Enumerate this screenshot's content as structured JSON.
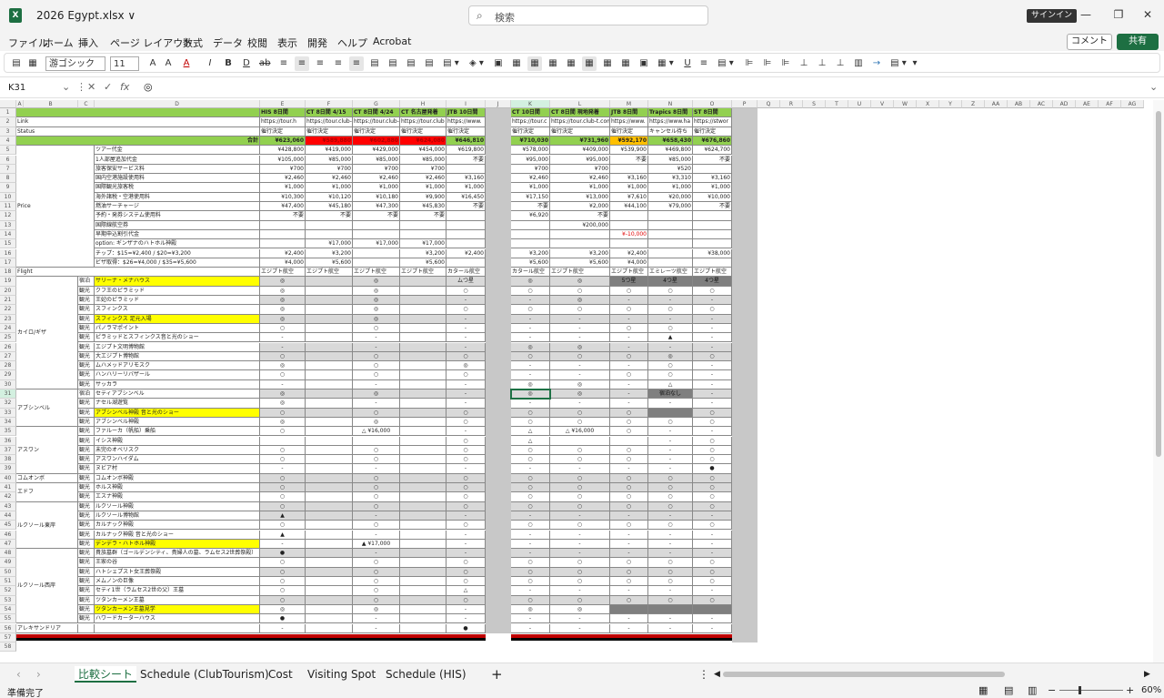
{
  "titlebar": {
    "file_title": "2026 Egypt.xlsx ∨",
    "search_placeholder": "検索",
    "signin_label": "サインイン",
    "minimize": "—",
    "restore": "❐",
    "close": "✕"
  },
  "menu": {
    "items": [
      "ファイル",
      "ホーム",
      "挿入",
      "ページ レイアウト",
      "数式",
      "データ",
      "校閲",
      "表示",
      "開発",
      "ヘルプ",
      "Acrobat"
    ],
    "comment_label": "コメント",
    "share_label": "共有"
  },
  "ribbon": {
    "font_name": "游ゴシック",
    "font_size": "11"
  },
  "formula_bar": {
    "cell_ref": "K31",
    "content": "◎"
  },
  "columns": [
    "A",
    "B",
    "C",
    "D",
    "E",
    "F",
    "G",
    "H",
    "I",
    "J",
    "K",
    "L",
    "M",
    "N",
    "O",
    "P",
    "Q",
    "R",
    "S",
    "T",
    "U",
    "V",
    "W",
    "X",
    "Y",
    "Z",
    "AA",
    "AB",
    "AC",
    "AD",
    "AE",
    "AF",
    "AG"
  ],
  "table": {
    "headers": [
      "HIS 8日間",
      "CT 8日間 4/15",
      "CT 8日間 4/24",
      "CT 名古屋発着",
      "JTB 10日間",
      "CT 10日間",
      "CT 8日間 現地発着",
      "JTB 8日間",
      "Trapics 8日間",
      "ST 8日間"
    ],
    "link_label": "Link",
    "links": [
      "https://tour.h",
      "https://tour.club-",
      "https://tour.club-",
      "https://tour.club",
      "https://www.",
      "https://tour.c",
      "https://tour.club-t.com",
      "https://www.",
      "https://www.ha",
      "https://stwor"
    ],
    "status_label": "Status",
    "statuses": [
      "催行決定",
      "催行決定",
      "催行決定",
      "催行決定",
      "催行決定",
      "催行決定",
      "催行決定",
      "催行決定",
      "キャンセル待ち",
      "催行決定"
    ],
    "total_label": "合計",
    "totals": [
      "¥623,060",
      "¥589,880",
      "¥602,880",
      "¥624,080",
      "¥646,810",
      "¥710,030",
      "¥731,960",
      "¥592,170",
      "¥658,430",
      "¥676,860"
    ],
    "price_label": "Price",
    "price_items": [
      {
        "label": "ツアー代金",
        "values": [
          "¥428,800",
          "¥419,000",
          "¥429,000",
          "¥454,000",
          "¥619,800",
          "¥578,000",
          "¥409,000",
          "¥539,900",
          "¥469,800",
          "¥624,700"
        ]
      },
      {
        "label": "1人部屋追加代金",
        "values": [
          "¥105,000",
          "¥85,000",
          "¥85,000",
          "¥85,000",
          "不要",
          "¥95,000",
          "¥95,000",
          "不要",
          "¥85,000",
          "不要"
        ]
      },
      {
        "label": "旅客保安サービス料",
        "values": [
          "¥700",
          "¥700",
          "¥700",
          "¥700",
          "",
          "¥700",
          "¥700",
          "",
          "¥520",
          ""
        ]
      },
      {
        "label": "国内空港施設使用料",
        "values": [
          "¥2,460",
          "¥2,460",
          "¥2,460",
          "¥2,460",
          "¥3,160",
          "¥2,460",
          "¥2,460",
          "¥3,160",
          "¥3,310",
          "¥3,160"
        ]
      },
      {
        "label": "国際観光旅客税",
        "values": [
          "¥1,000",
          "¥1,000",
          "¥1,000",
          "¥1,000",
          "¥1,000",
          "¥1,000",
          "¥1,000",
          "¥1,000",
          "¥1,000",
          "¥1,000"
        ]
      },
      {
        "label": "海外諸税・空港使用料",
        "values": [
          "¥10,300",
          "¥10,120",
          "¥10,180",
          "¥9,900",
          "¥16,450",
          "¥17,150",
          "¥13,000",
          "¥7,610",
          "¥20,000",
          "¥10,000"
        ]
      },
      {
        "label": "燃油サーチャージ",
        "values": [
          "¥47,400",
          "¥45,180",
          "¥47,300",
          "¥45,830",
          "不要",
          "不要",
          "¥2,000",
          "¥44,100",
          "¥79,000",
          "不要"
        ]
      },
      {
        "label": "予約・発券システム使用料",
        "values": [
          "不要",
          "不要",
          "不要",
          "不要",
          "",
          "¥6,920",
          "不要",
          "",
          "",
          ""
        ]
      },
      {
        "label": "国際線航空券",
        "values": [
          "",
          "",
          "",
          "",
          "",
          "",
          "¥200,000",
          "",
          "",
          ""
        ]
      },
      {
        "label": "早期申込割引代金",
        "values": [
          "",
          "",
          "",
          "",
          "",
          "",
          "",
          "¥-10,000",
          "",
          ""
        ]
      },
      {
        "label": "option: ギンザナのハトホル神殿",
        "values": [
          "",
          "¥17,000",
          "¥17,000",
          "¥17,000",
          "",
          "",
          "",
          "",
          "",
          ""
        ]
      },
      {
        "label": "チップ：$15=¥2,400 / $20=¥3,200",
        "values": [
          "¥2,400",
          "¥3,200",
          "",
          "¥3,200",
          "¥2,400",
          "¥3,200",
          "¥3,200",
          "¥2,400",
          "",
          "¥38,000"
        ]
      },
      {
        "label": "ビザ取得：$26=¥4,000 / $35=¥5,600",
        "values": [
          "¥4,000",
          "¥5,600",
          "",
          "¥5,600",
          "",
          "¥5,600",
          "¥5,600",
          "¥4,000",
          "",
          ""
        ]
      }
    ],
    "flight_label": "Flight",
    "flights": [
      "エジプト航空",
      "エジプト航空",
      "エジプト航空",
      "エジプト航空",
      "カタール航空",
      "カタール航空",
      "エジプト航空",
      "エジプト航空",
      "エミレーツ航空",
      "エジプト航空"
    ],
    "regions": [
      "カイロ/ギザ",
      "アブシンベル",
      "アスワン",
      "コムオンボ",
      "エドフ",
      "ルクソール東岸",
      "ルクソール西岸",
      "アレキサンドリア"
    ],
    "sights": [
      {
        "type": "宿泊",
        "name": "サリーナ・メナハウス",
        "yellow": true,
        "v": [
          "◎",
          "",
          "◎",
          "",
          "ムつ星",
          "◎",
          "◎",
          "5つ星",
          "4つ星",
          "4つ星"
        ]
      },
      {
        "type": "観光",
        "name": "クフ王のピラミッド",
        "v": [
          "◎",
          "",
          "◎",
          "",
          "○",
          "○",
          "○",
          "○",
          "○",
          "○"
        ]
      },
      {
        "type": "観光",
        "name": "王妃のピラミッド",
        "v": [
          "◎",
          "",
          "◎",
          "",
          "-",
          "-",
          "◎",
          "-",
          "-",
          "-"
        ]
      },
      {
        "type": "観光",
        "name": "スフィンクス",
        "v": [
          "◎",
          "",
          "◎",
          "",
          "○",
          "○",
          "○",
          "○",
          "○",
          "○"
        ]
      },
      {
        "type": "観光",
        "name": "スフィンクス 足元入場",
        "yellow": true,
        "v": [
          "◎",
          "",
          "◎",
          "",
          "-",
          "-",
          "-",
          "-",
          "-",
          "-"
        ]
      },
      {
        "type": "観光",
        "name": "パノラマポイント",
        "v": [
          "○",
          "",
          "○",
          "",
          "-",
          "-",
          "-",
          "○",
          "○",
          "-"
        ]
      },
      {
        "type": "観光",
        "name": "ピラミッドとスフィンクス音と光のショー",
        "v": [
          "-",
          "",
          "-",
          "",
          "-",
          "-",
          "-",
          "-",
          "▲",
          "-"
        ]
      },
      {
        "type": "観光",
        "name": "エジプト文明博物館",
        "v": [
          "-",
          "",
          "-",
          "",
          "-",
          "◎",
          "◎",
          "-",
          "-",
          "-"
        ]
      },
      {
        "type": "観光",
        "name": "大エジプト博物館",
        "v": [
          "○",
          "",
          "○",
          "",
          "○",
          "○",
          "○",
          "○",
          "◎",
          "○"
        ]
      },
      {
        "type": "観光",
        "name": "ムハメッドアリモスク",
        "v": [
          "◎",
          "",
          "○",
          "",
          "◎",
          "-",
          "-",
          "-",
          "○",
          "-"
        ]
      },
      {
        "type": "観光",
        "name": "ハンハリーリバザール",
        "v": [
          "○",
          "",
          "○",
          "",
          "○",
          "-",
          "-",
          "○",
          "○",
          "-"
        ]
      },
      {
        "type": "観光",
        "name": "サッカラ",
        "v": [
          "-",
          "",
          "-",
          "",
          "-",
          "◎",
          "◎",
          "-",
          "△",
          "-"
        ]
      },
      {
        "type": "宿泊",
        "name": "セティアブシンベル",
        "v": [
          "◎",
          "",
          "◎",
          "",
          "-",
          "◎",
          "◎",
          "-",
          "宿泊なし",
          "-"
        ]
      },
      {
        "type": "観光",
        "name": "ナセル湖遊覧",
        "v": [
          "◎",
          "",
          "-",
          "",
          "-",
          "-",
          "-",
          "-",
          "-",
          "-"
        ]
      },
      {
        "type": "観光",
        "name": "アブシンベル神殿 音と光のショー",
        "yellow": true,
        "v": [
          "○",
          "",
          "○",
          "",
          "○",
          "○",
          "○",
          "○",
          "",
          "○"
        ]
      },
      {
        "type": "観光",
        "name": "アブシンベル神殿",
        "v": [
          "◎",
          "",
          "◎",
          "",
          "○",
          "○",
          "○",
          "○",
          "○",
          "○"
        ]
      },
      {
        "type": "観光",
        "name": "ファルーカ（帆船）乗船",
        "v": [
          "○",
          "",
          "△ ¥16,000",
          "",
          "-",
          "△",
          "△ ¥16,000",
          "○",
          "-",
          "-"
        ]
      },
      {
        "type": "観光",
        "name": "イシス神殿",
        "v": [
          "",
          "",
          "",
          "",
          "○",
          "△",
          "",
          "",
          "-",
          "○"
        ]
      },
      {
        "type": "観光",
        "name": "未完のオベリスク",
        "v": [
          "○",
          "",
          "○",
          "",
          "○",
          "○",
          "○",
          "○",
          "-",
          "○"
        ]
      },
      {
        "type": "観光",
        "name": "アスワンハイダム",
        "v": [
          "○",
          "",
          "○",
          "",
          "○",
          "○",
          "○",
          "○",
          "-",
          "○"
        ]
      },
      {
        "type": "観光",
        "name": "ヌビア村",
        "v": [
          "-",
          "",
          "-",
          "",
          "-",
          "-",
          "-",
          "-",
          "-",
          "●"
        ]
      },
      {
        "type": "観光",
        "name": "コムオンボ神殿",
        "v": [
          "○",
          "",
          "○",
          "",
          "○",
          "○",
          "○",
          "○",
          "○",
          "○"
        ]
      },
      {
        "type": "観光",
        "name": "ホルス神殿",
        "v": [
          "○",
          "",
          "○",
          "",
          "○",
          "○",
          "○",
          "○",
          "○",
          "○"
        ]
      },
      {
        "type": "観光",
        "name": "エスナ神殿",
        "v": [
          "○",
          "",
          "○",
          "",
          "○",
          "○",
          "○",
          "○",
          "○",
          "○"
        ]
      },
      {
        "type": "観光",
        "name": "ルクソール神殿",
        "v": [
          "○",
          "",
          "○",
          "",
          "○",
          "○",
          "○",
          "○",
          "○",
          "○"
        ]
      },
      {
        "type": "観光",
        "name": "ルクソール博物館",
        "v": [
          "▲",
          "",
          "-",
          "",
          "-",
          "-",
          "-",
          "-",
          "-",
          "-"
        ]
      },
      {
        "type": "観光",
        "name": "カルナック神殿",
        "v": [
          "○",
          "",
          "○",
          "",
          "○",
          "○",
          "○",
          "○",
          "○",
          "○"
        ]
      },
      {
        "type": "観光",
        "name": "カルナック神殿 音と光のショー",
        "v": [
          "▲",
          "",
          "-",
          "",
          "-",
          "-",
          "-",
          "-",
          "-",
          "-"
        ]
      },
      {
        "type": "観光",
        "name": "デンデラ・ハトホル神殿",
        "yellow": true,
        "v": [
          "-",
          "",
          "▲ ¥17,000",
          "",
          "-",
          "-",
          "-",
          "-",
          "-",
          "-"
        ]
      },
      {
        "type": "観光",
        "name": "貴族墓群（ゴールデンシティ、貴婦人の墓、ラムセス2世葬祭殿）",
        "v": [
          "●",
          "",
          "-",
          "",
          "-",
          "-",
          "-",
          "-",
          "-",
          "-"
        ]
      },
      {
        "type": "観光",
        "name": "王家の谷",
        "v": [
          "○",
          "",
          "○",
          "",
          "○",
          "○",
          "○",
          "○",
          "○",
          "○"
        ]
      },
      {
        "type": "観光",
        "name": "ハトシェプスト女王葬祭殿",
        "v": [
          "○",
          "",
          "○",
          "",
          "○",
          "○",
          "○",
          "○",
          "○",
          "○"
        ]
      },
      {
        "type": "観光",
        "name": "メムノンの巨像",
        "v": [
          "○",
          "",
          "○",
          "",
          "○",
          "○",
          "○",
          "○",
          "○",
          "○"
        ]
      },
      {
        "type": "観光",
        "name": "セティ1世（ラムセス2世の父）王墓",
        "v": [
          "○",
          "",
          "○",
          "",
          "△",
          "-",
          "-",
          "-",
          "-",
          "-"
        ]
      },
      {
        "type": "観光",
        "name": "ツタンカーメン王墓",
        "v": [
          "○",
          "",
          "○",
          "",
          "○",
          "○",
          "○",
          "○",
          "○",
          "○"
        ]
      },
      {
        "type": "観光",
        "name": "ツタンカーメン王墓見学",
        "yellow": true,
        "v": [
          "◎",
          "",
          "◎",
          "",
          "-",
          "◎",
          "◎",
          "",
          "",
          ""
        ]
      },
      {
        "type": "観光",
        "name": "ハワードカーターハウス",
        "v": [
          "●",
          "",
          "-",
          "",
          "-",
          "-",
          "-",
          "-",
          "-",
          "-"
        ]
      },
      {
        "type": "",
        "name": "",
        "v": [
          "-",
          "",
          "-",
          "",
          "●",
          "-",
          "-",
          "-",
          "-",
          "-"
        ]
      }
    ]
  },
  "tabs": [
    "比較シート",
    "Schedule (ClubTourism)",
    "Cost",
    "Visiting Spot",
    "Schedule (HIS)"
  ],
  "status": {
    "ready": "準備完了",
    "zoom": "60%"
  }
}
